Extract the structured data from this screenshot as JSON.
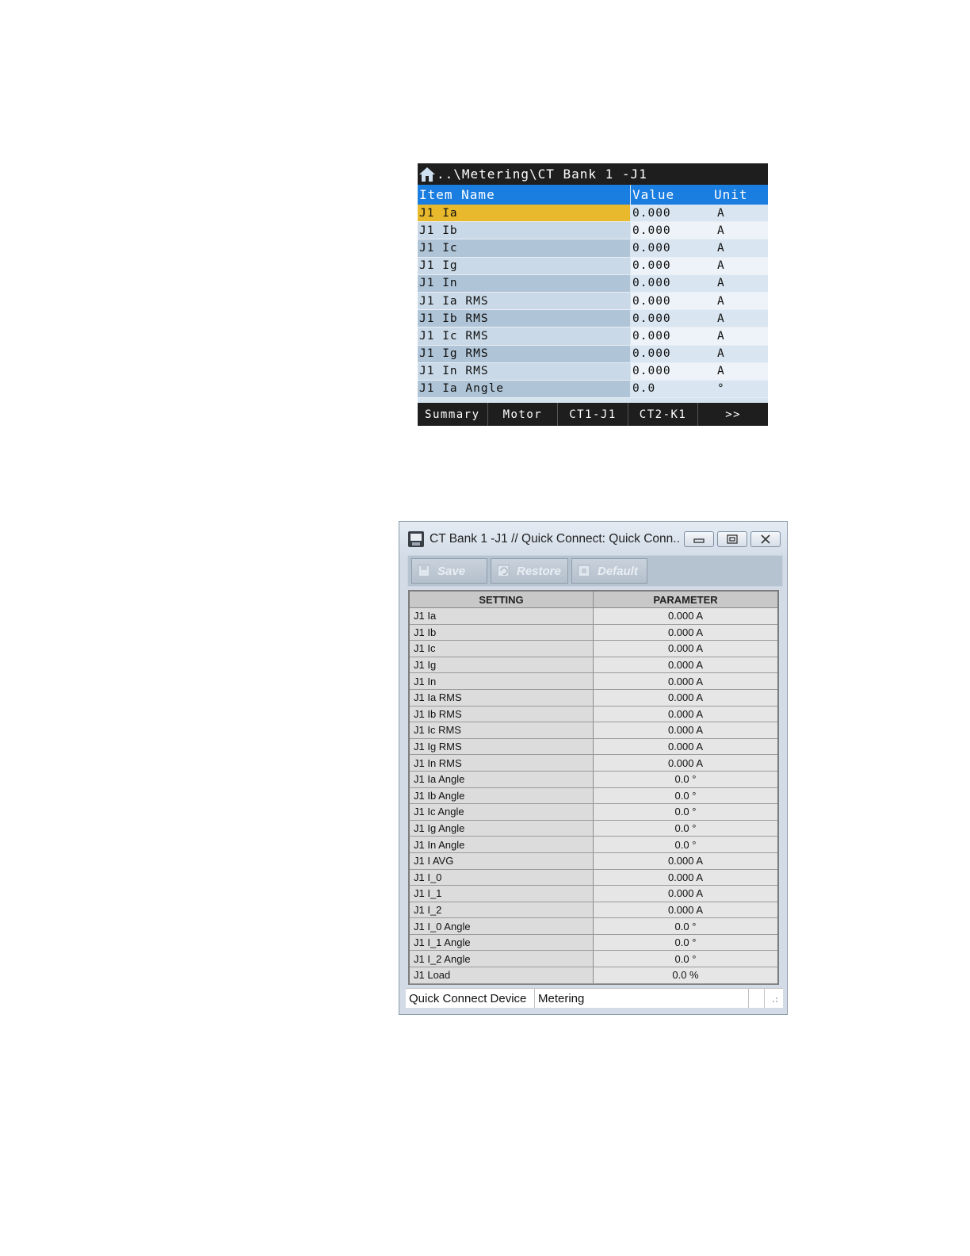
{
  "lcd": {
    "path": "..\\Metering\\CT Bank 1 -J1",
    "headers": {
      "name": "Item Name",
      "value": "Value",
      "unit": "Unit"
    },
    "rows": [
      {
        "name": "J1 Ia",
        "value": "0.000",
        "unit": "A"
      },
      {
        "name": "J1 Ib",
        "value": "0.000",
        "unit": "A"
      },
      {
        "name": "J1 Ic",
        "value": "0.000",
        "unit": "A"
      },
      {
        "name": "J1 Ig",
        "value": "0.000",
        "unit": "A"
      },
      {
        "name": "J1 In",
        "value": "0.000",
        "unit": "A"
      },
      {
        "name": "J1 Ia RMS",
        "value": "0.000",
        "unit": "A"
      },
      {
        "name": "J1 Ib RMS",
        "value": "0.000",
        "unit": "A"
      },
      {
        "name": "J1 Ic RMS",
        "value": "0.000",
        "unit": "A"
      },
      {
        "name": "J1 Ig RMS",
        "value": "0.000",
        "unit": "A"
      },
      {
        "name": "J1 In RMS",
        "value": "0.000",
        "unit": "A"
      },
      {
        "name": "J1 Ia Angle",
        "value": "0.0",
        "unit": "°"
      }
    ],
    "tabs": [
      "Summary",
      "Motor",
      "CT1-J1",
      "CT2-K1",
      ">>"
    ],
    "selected_row": "J1 Ia",
    "colors": {
      "header": "#1a7de0",
      "selected": "#e8b92c",
      "bar": "#1e1e1e"
    }
  },
  "window": {
    "title": "CT Bank 1 -J1 // Quick Connect: Quick Conn...",
    "toolbar": {
      "save": "Save",
      "restore": "Restore",
      "default": "Default"
    },
    "headers": {
      "setting": "SETTING",
      "parameter": "PARAMETER"
    },
    "rows": [
      {
        "setting": "J1 Ia",
        "parameter": "0.000 A"
      },
      {
        "setting": "J1 Ib",
        "parameter": "0.000 A"
      },
      {
        "setting": "J1 Ic",
        "parameter": "0.000 A"
      },
      {
        "setting": "J1 Ig",
        "parameter": "0.000 A"
      },
      {
        "setting": "J1 In",
        "parameter": "0.000 A"
      },
      {
        "setting": "J1 Ia RMS",
        "parameter": "0.000 A"
      },
      {
        "setting": "J1 Ib RMS",
        "parameter": "0.000 A"
      },
      {
        "setting": "J1 Ic RMS",
        "parameter": "0.000 A"
      },
      {
        "setting": "J1 Ig RMS",
        "parameter": "0.000 A"
      },
      {
        "setting": "J1 In RMS",
        "parameter": "0.000 A"
      },
      {
        "setting": "J1 Ia Angle",
        "parameter": "0.0 °"
      },
      {
        "setting": "J1 Ib Angle",
        "parameter": "0.0 °"
      },
      {
        "setting": "J1 Ic Angle",
        "parameter": "0.0 °"
      },
      {
        "setting": "J1 Ig Angle",
        "parameter": "0.0 °"
      },
      {
        "setting": "J1 In Angle",
        "parameter": "0.0 °"
      },
      {
        "setting": "J1 I AVG",
        "parameter": "0.000 A"
      },
      {
        "setting": "J1 I_0",
        "parameter": "0.000 A"
      },
      {
        "setting": "J1 I_1",
        "parameter": "0.000 A"
      },
      {
        "setting": "J1 I_2",
        "parameter": "0.000 A"
      },
      {
        "setting": "J1 I_0 Angle",
        "parameter": "0.0 °"
      },
      {
        "setting": "J1 I_1 Angle",
        "parameter": "0.0 °"
      },
      {
        "setting": "J1 I_2 Angle",
        "parameter": "0.0 °"
      },
      {
        "setting": "J1 Load",
        "parameter": "0.0 %"
      }
    ],
    "status": {
      "device": "Quick Connect Device",
      "mode": "Metering"
    }
  }
}
